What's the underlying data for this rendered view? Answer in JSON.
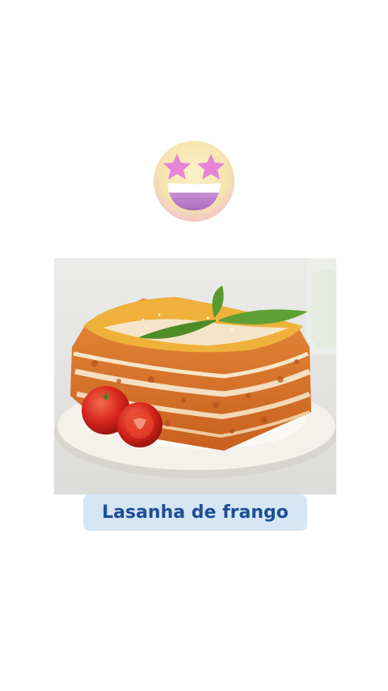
{
  "emoji": {
    "icon": "star-struck-emoji-icon",
    "face_color": "#f7e9b8",
    "star_color": "#e884d8",
    "mouth_color": "#b778c9"
  },
  "photo": {
    "subject": "lasagna-photo",
    "background_color": "#e9e8e6",
    "plate_color": "#f3efea",
    "sauce_color": "#d9722a",
    "pasta_color": "#f0b13a",
    "tomato_color": "#d7261d",
    "basil_color": "#5a9a2f"
  },
  "caption": {
    "text": "Lasanha de frango",
    "background": "#d6e6f5",
    "color": "#1f4e96"
  }
}
